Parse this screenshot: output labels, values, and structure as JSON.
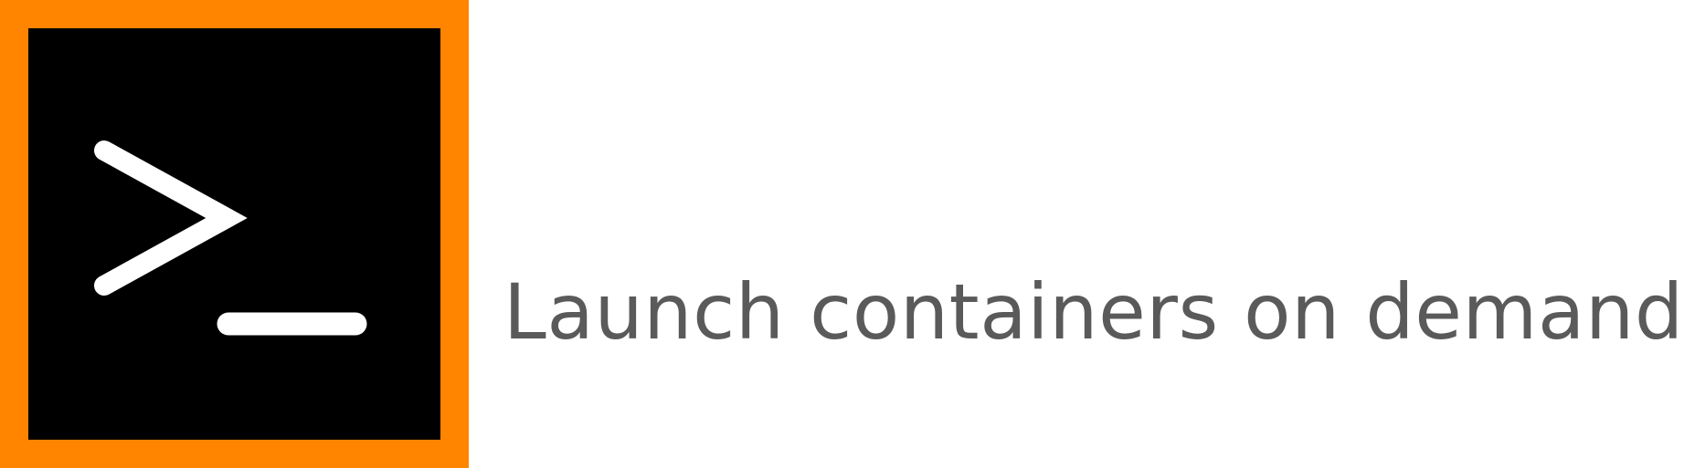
{
  "logo": {
    "icon": "terminal-prompt-icon",
    "frame_color": "#ff8400",
    "background_color": "#000000",
    "glyph_color": "#ffffff"
  },
  "tagline": {
    "text": "Launch containers on demand",
    "color": "#5a5a5a"
  }
}
